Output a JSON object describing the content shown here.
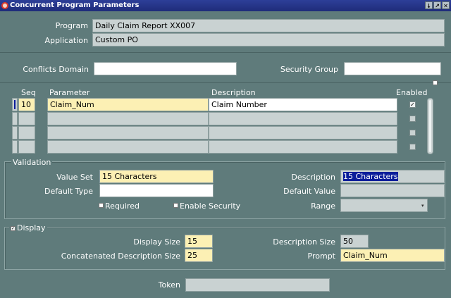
{
  "window": {
    "title": "Concurrent Program Parameters",
    "controls": [
      "↓",
      "↗",
      "✕"
    ]
  },
  "header": {
    "program_label": "Program",
    "program_value": "Daily Claim Report XX007",
    "application_label": "Application",
    "application_value": "Custom PO"
  },
  "filters": {
    "conflicts_label": "Conflicts Domain",
    "conflicts_value": "",
    "security_label": "Security Group",
    "security_value": ""
  },
  "grid": {
    "col_seq": "Seq",
    "col_parameter": "Parameter",
    "col_description": "Description",
    "col_enabled": "Enabled",
    "rows": [
      {
        "seq": "10",
        "parameter": "Claim_Num",
        "description": "Claim Number",
        "enabled": true
      },
      {
        "seq": "",
        "parameter": "",
        "description": "",
        "enabled": false
      },
      {
        "seq": "",
        "parameter": "",
        "description": "",
        "enabled": false
      },
      {
        "seq": "",
        "parameter": "",
        "description": "",
        "enabled": false
      }
    ]
  },
  "validation": {
    "section_label": "Validation",
    "value_set_label": "Value Set",
    "value_set_value": "15 Characters",
    "default_type_label": "Default Type",
    "default_type_value": "",
    "description_label": "Description",
    "description_value": "15 Characters",
    "default_value_label": "Default Value",
    "default_value_value": "",
    "required_label": "Required",
    "enable_security_label": "Enable Security",
    "range_label": "Range",
    "range_value": ""
  },
  "display": {
    "section_label": "Display",
    "display_size_label": "Display Size",
    "display_size_value": "15",
    "concat_label": "Concatenated Description Size",
    "concat_value": "25",
    "desc_size_label": "Description Size",
    "desc_size_value": "50",
    "prompt_label": "Prompt",
    "prompt_value": "Claim_Num"
  },
  "token": {
    "label": "Token",
    "value": ""
  }
}
